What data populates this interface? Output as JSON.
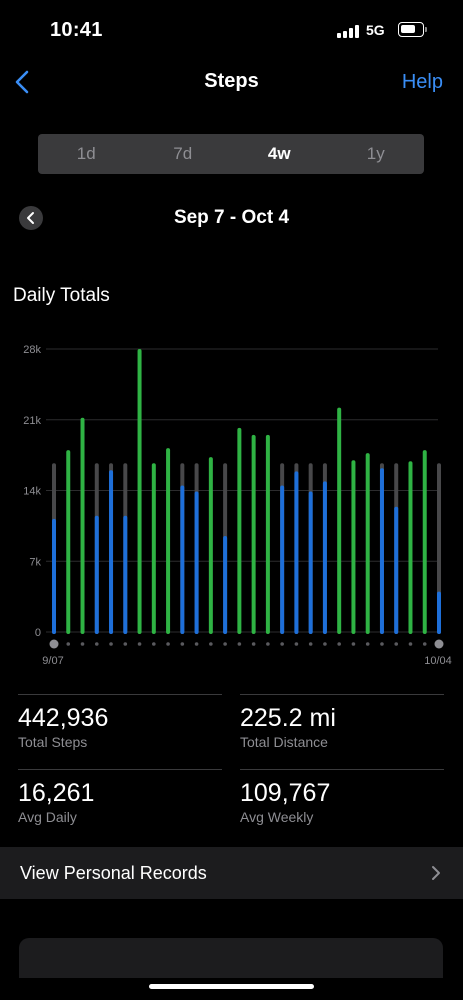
{
  "status_bar": {
    "time": "10:41",
    "network": "5G"
  },
  "nav": {
    "title": "Steps",
    "help_label": "Help"
  },
  "segments": [
    {
      "label": "1d",
      "active": false
    },
    {
      "label": "7d",
      "active": false
    },
    {
      "label": "4w",
      "active": true
    },
    {
      "label": "1y",
      "active": false
    }
  ],
  "range": {
    "label": "Sep 7 - Oct 4"
  },
  "section": {
    "title": "Daily Totals"
  },
  "colors": {
    "goal_met": "#2fb344",
    "below_goal": "#1e6fd9",
    "goal_track": "#48484a",
    "accent": "#3a8ef6"
  },
  "chart_data": {
    "type": "bar",
    "title": "Daily Totals",
    "ylim": [
      0,
      28000
    ],
    "y_ticks": [
      "28k",
      "21k",
      "14k",
      "7k",
      "0"
    ],
    "x_tick_labels": [
      "9/07",
      "10/04"
    ],
    "goal": 16500,
    "values": [
      11000,
      17800,
      21000,
      11300,
      15800,
      11300,
      27800,
      16500,
      18000,
      14300,
      13700,
      17100,
      9300,
      20000,
      19300,
      19300,
      14300,
      15700,
      13700,
      14700,
      22000,
      16800,
      17500,
      16000,
      12200,
      16700,
      17800,
      3800
    ]
  },
  "stats": [
    {
      "value": "442,936",
      "label": "Total Steps"
    },
    {
      "value": "225.2 mi",
      "label": "Total Distance"
    },
    {
      "value": "16,261",
      "label": "Avg Daily"
    },
    {
      "value": "109,767",
      "label": "Avg Weekly"
    }
  ],
  "records": {
    "label": "View Personal Records"
  }
}
